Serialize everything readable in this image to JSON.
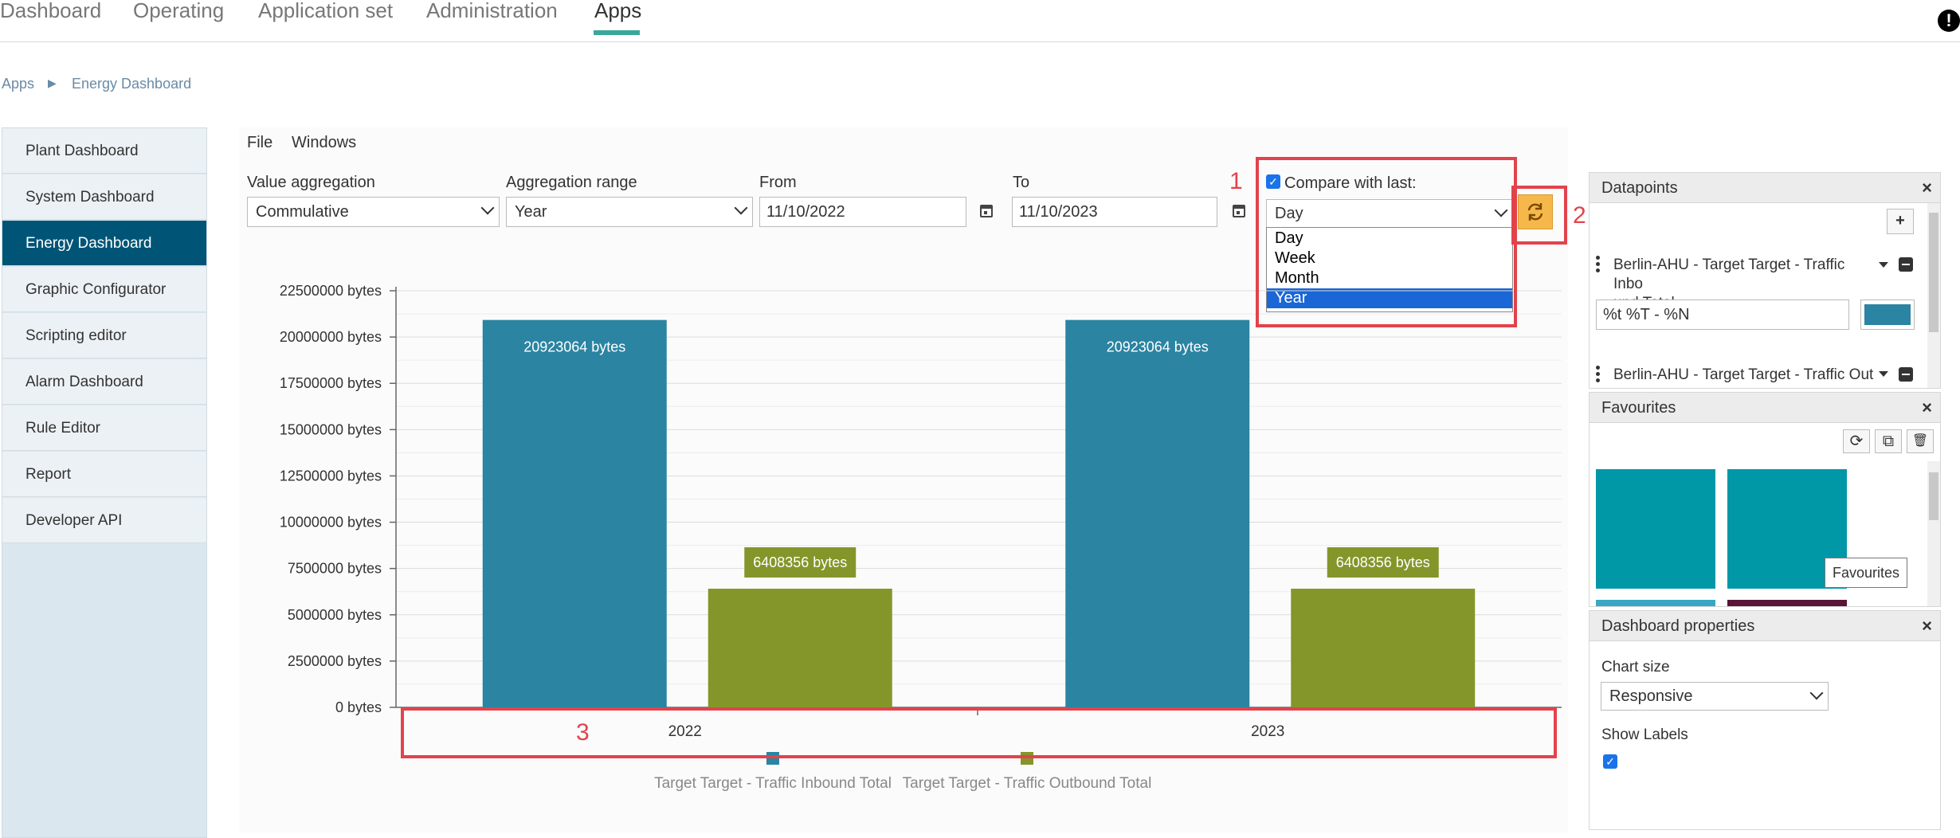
{
  "nav": {
    "tabs": [
      {
        "label": "Dashboard"
      },
      {
        "label": "Operating"
      },
      {
        "label": "Application set"
      },
      {
        "label": "Administration"
      },
      {
        "label": "Apps"
      }
    ],
    "active_tab": "Apps",
    "alert_glyph": "!"
  },
  "breadcrumb": {
    "root": "Apps",
    "separator": "▶",
    "current": "Energy Dashboard"
  },
  "sidebar": {
    "items": [
      {
        "label": "Plant Dashboard"
      },
      {
        "label": "System Dashboard"
      },
      {
        "label": "Energy Dashboard"
      },
      {
        "label": "Graphic Configurator"
      },
      {
        "label": "Scripting editor"
      },
      {
        "label": "Alarm Dashboard"
      },
      {
        "label": "Rule Editor"
      },
      {
        "label": "Report"
      },
      {
        "label": "Developer API"
      }
    ],
    "active_item": "Energy Dashboard",
    "active_color": "#005577"
  },
  "menu": {
    "file": "File",
    "windows": "Windows"
  },
  "filters": {
    "value_aggregation": {
      "label": "Value aggregation",
      "value": "Commulative"
    },
    "aggregation_range": {
      "label": "Aggregation range",
      "value": "Year"
    },
    "from": {
      "label": "From",
      "value": "11/10/2022"
    },
    "to": {
      "label": "To",
      "value": "11/10/2023"
    }
  },
  "compare": {
    "label": "Compare with last:",
    "checked": true,
    "selected": "Day",
    "options": [
      "Day",
      "Week",
      "Month",
      "Year"
    ],
    "highlighted_option": "Year"
  },
  "annotations": [
    "1",
    "2",
    "3"
  ],
  "chart_data": {
    "type": "bar",
    "categories": [
      "2022",
      "2023"
    ],
    "series": [
      {
        "name": "Target Target - Traffic Inbound Total",
        "values": [
          20923064,
          20923064
        ],
        "color": "#2a84a2",
        "labels": [
          "20923064 bytes",
          "20923064 bytes"
        ]
      },
      {
        "name": "Target Target - Traffic Outbound Total",
        "values": [
          6408356,
          6408356
        ],
        "color": "#84962a",
        "labels": [
          "6408356 bytes",
          "6408356 bytes"
        ]
      }
    ],
    "ylim": [
      0,
      22500000
    ],
    "yticks": [
      {
        "value": 0,
        "label": "0 bytes"
      },
      {
        "value": 2500000,
        "label": "2500000 bytes"
      },
      {
        "value": 5000000,
        "label": "5000000 bytes"
      },
      {
        "value": 7500000,
        "label": "7500000 bytes"
      },
      {
        "value": 10000000,
        "label": "10000000 bytes"
      },
      {
        "value": 12500000,
        "label": "12500000 bytes"
      },
      {
        "value": 15000000,
        "label": "15000000 bytes"
      },
      {
        "value": 17500000,
        "label": "17500000 bytes"
      },
      {
        "value": 20000000,
        "label": "20000000 bytes"
      },
      {
        "value": 22500000,
        "label": "22500000 bytes"
      }
    ],
    "grid": true,
    "legend_position": "bottom"
  },
  "datapoints": {
    "title": "Datapoints",
    "close": "×",
    "add": "+",
    "item1_line1": "Berlin-AHU - Target Target - Traffic Inbo",
    "item1_line2": "und Total",
    "format": "%t %T - %N",
    "swatch_color": "#2a84a2",
    "item2": "Berlin-AHU - Target Target - Traffic Out"
  },
  "favourites": {
    "title": "Favourites",
    "close": "×",
    "refresh": "⟳",
    "resize": "⧉",
    "delete": "🗑",
    "tooltip": "Favourites",
    "tile_colors": [
      "#0097a7",
      "#0097a7",
      "#3aa7c5",
      "#5a1436"
    ]
  },
  "dashboard_properties": {
    "title": "Dashboard properties",
    "close": "×",
    "chart_size_label": "Chart size",
    "chart_size_value": "Responsive",
    "show_labels_label": "Show Labels",
    "show_labels_checked": true
  }
}
